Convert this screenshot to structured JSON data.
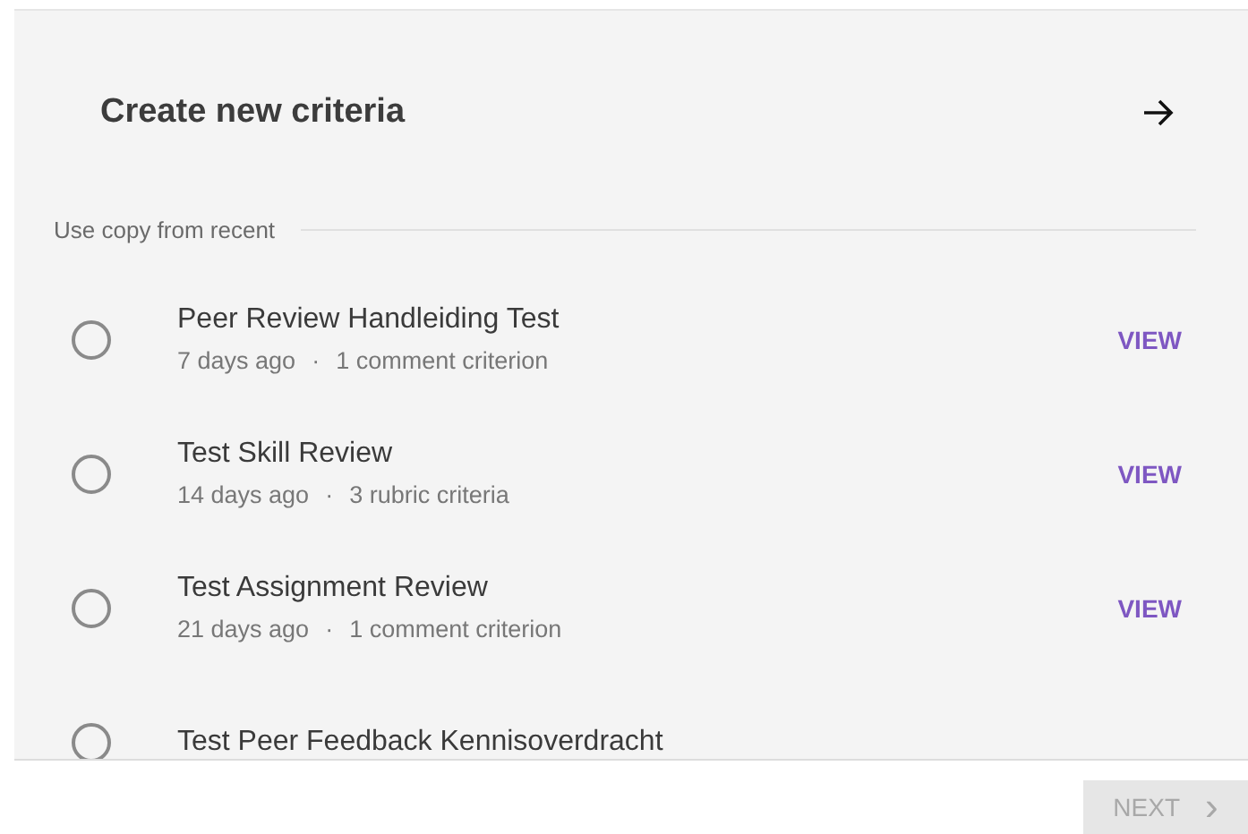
{
  "header": {
    "title": "Create new criteria"
  },
  "section_label": "Use copy from recent",
  "items": [
    {
      "title": "Peer Review Handleiding Test",
      "age": "7 days ago",
      "separator": "·",
      "detail": "1 comment criterion",
      "action": "VIEW",
      "selected": false
    },
    {
      "title": "Test Skill Review",
      "age": "14 days ago",
      "separator": "·",
      "detail": "3 rubric criteria",
      "action": "VIEW",
      "selected": false
    },
    {
      "title": "Test Assignment Review",
      "age": "21 days ago",
      "separator": "·",
      "detail": "1 comment criterion",
      "action": "VIEW",
      "selected": false
    },
    {
      "title": "Test Peer Feedback Kennisoverdracht",
      "selected": false
    }
  ],
  "next_button": {
    "label": "NEXT",
    "icon": "›",
    "disabled": true
  }
}
